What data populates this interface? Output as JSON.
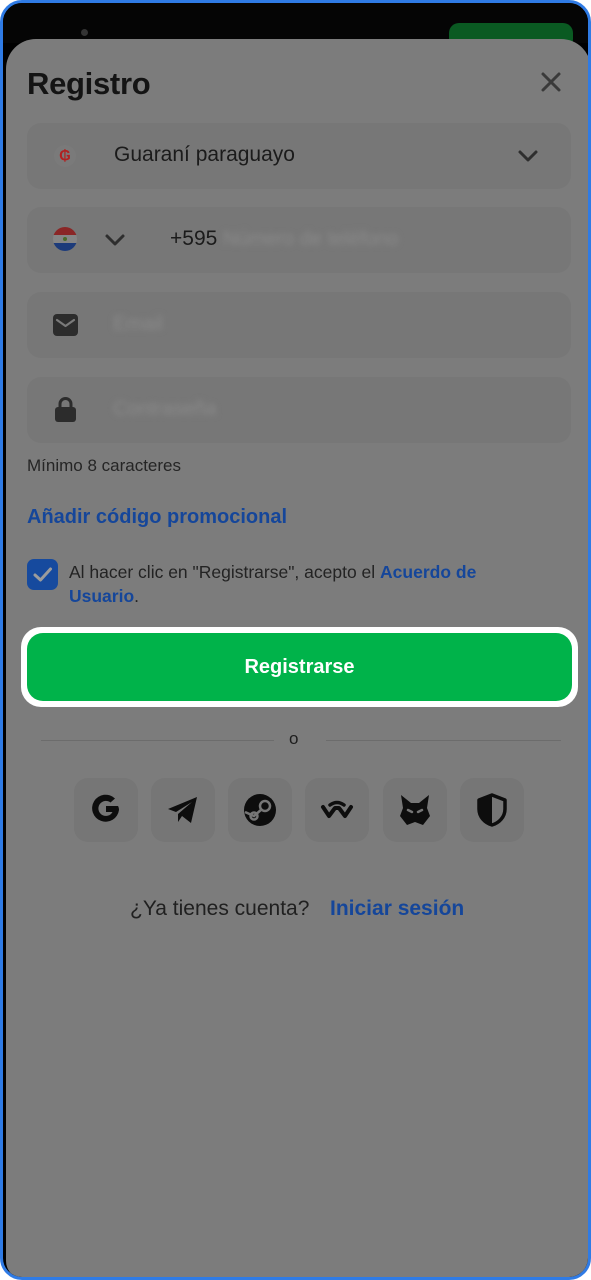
{
  "header": {
    "title": "Registro",
    "close_icon": "close-icon"
  },
  "form": {
    "currency": {
      "value": "Guaraní paraguayo",
      "icon": "guarani-currency-icon",
      "symbol": "₲"
    },
    "phone": {
      "country_code": "+595",
      "placeholder": "Número de teléfono",
      "flag_icon": "paraguay-flag-icon"
    },
    "email": {
      "placeholder": "Email",
      "icon": "mail-icon"
    },
    "password": {
      "placeholder": "Contraseña",
      "icon": "lock-icon",
      "hint": "Mínimo 8 caracteres"
    },
    "promo_link": "Añadir código promocional",
    "terms": {
      "checked": true,
      "text": "Al hacer clic en \"Registrarse\", acepto el ",
      "link": "Acuerdo de Usuario",
      "end": "."
    },
    "submit_label": "Registrarse"
  },
  "divider_label": "o",
  "social_icons": [
    "google-icon",
    "telegram-icon",
    "steam-icon",
    "walletconnect-icon",
    "metamask-icon",
    "shield-icon"
  ],
  "footer": {
    "question": "¿Ya tienes cuenta?",
    "login_link": "Iniciar sesión"
  },
  "colors": {
    "accent_green": "#00b34a",
    "link_blue": "#15469a",
    "overlay": "#7c7c7c",
    "frame_border": "#2f7be5"
  }
}
